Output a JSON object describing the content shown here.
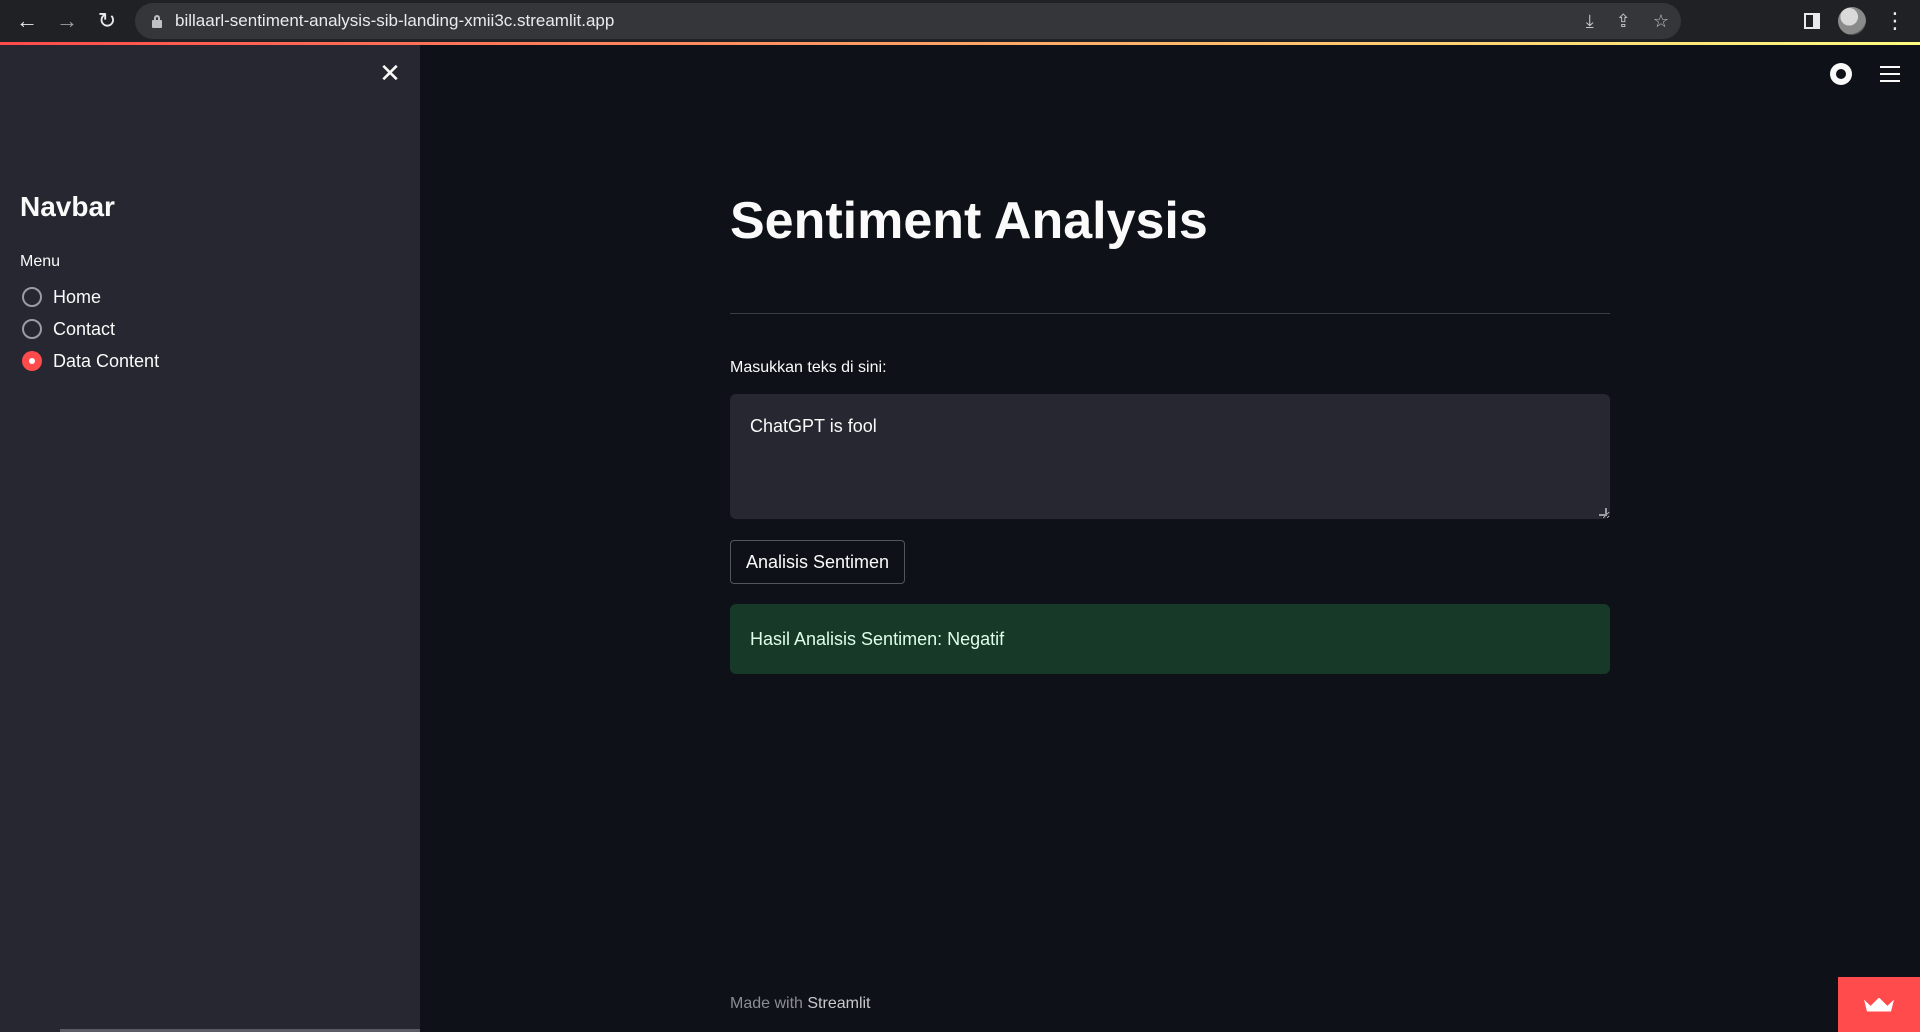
{
  "browser": {
    "url": "billaarl-sentiment-analysis-sib-landing-xmii3c.streamlit.app",
    "back_icon": "←",
    "forward_icon": "→",
    "reload_icon": "↻",
    "install_icon": "⤓",
    "share_icon": "⇪",
    "bookmark_icon": "☆",
    "menu_icon": "⋮"
  },
  "sidebar": {
    "close_icon": "✕",
    "title": "Navbar",
    "menu_label": "Menu",
    "items": [
      {
        "label": "Home",
        "checked": false
      },
      {
        "label": "Contact",
        "checked": false
      },
      {
        "label": "Data Content",
        "checked": true
      }
    ]
  },
  "main": {
    "title": "Sentiment Analysis",
    "input_label": "Masukkan teks di sini:",
    "input_value": "ChatGPT is fool",
    "button_label": "Analisis Sentimen",
    "result_text": "Hasil Analisis Sentimen: Negatif"
  },
  "footer": {
    "prefix": "Made with ",
    "brand": "Streamlit"
  },
  "colors": {
    "accent": "#ff4b4b",
    "background": "#0e1117",
    "sidebar": "#262730",
    "success_bg": "#173928"
  }
}
